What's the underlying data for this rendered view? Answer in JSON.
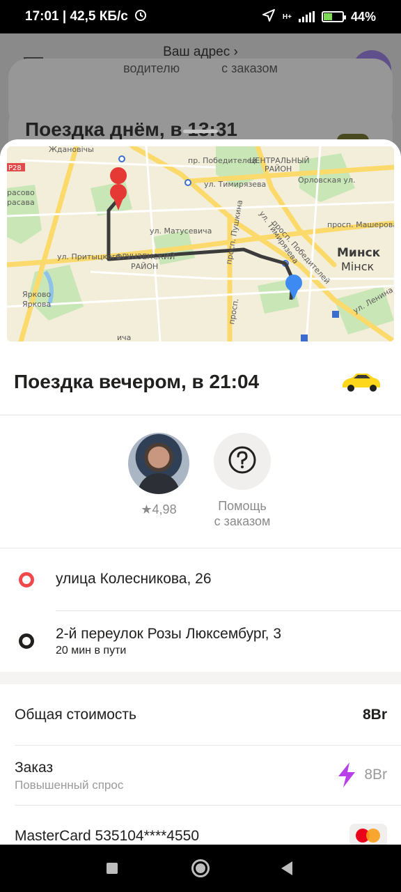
{
  "status_bar": {
    "time_speed": "17:01 | 42,5 КБ/с",
    "network": "H+",
    "battery": "44%"
  },
  "background": {
    "address_link": "Ваш адрес ›",
    "chips": [
      "водителю",
      "с заказом"
    ],
    "trip_title": "Поездка днём, в 13:31"
  },
  "map": {
    "labels": {
      "zhdanovichi": "Ждановічы",
      "pobediteley_top": "пр. Победителей",
      "center_district": "ЦЕНТРАЛЬНЫЙ",
      "district_word": "РАЙОН",
      "timiryazeva": "ул. Тимирязева",
      "orlovskaya": "Орловская ул.",
      "road_code": "Р28",
      "krasovo": "расово",
      "krasava": "расава",
      "pobediteley_side": "просп. Победителей",
      "masherova": "просп. Машерова",
      "matusevicha": "ул. Матусевича",
      "pushkina": "просп. Пушкина",
      "timiryazeva_side": "ул. Тимирязева",
      "minsk_ru": "Минск",
      "minsk_by": "Мінск",
      "pritytskogo": "ул. Притыцкого",
      "frunzensky": "ФРУНЗЕНСКИЙ",
      "frunzensky_district": "РАЙОН",
      "yarkovo_ru": "Ярково",
      "yarkovo_by": "Яркова",
      "lenina": "ул. Ленина",
      "prosp_bottom": "просп.",
      "scha": "ича"
    }
  },
  "trip": {
    "title": "Поездка вечером, в 21:04",
    "driver_rating": "★4,98",
    "help_label_line1": "Помощь",
    "help_label_line2": "с заказом"
  },
  "route": {
    "from": "улица Колесникова, 26",
    "to": "2-й переулок Розы Люксембург, 3",
    "duration": "20 мин в пути"
  },
  "price": {
    "total_label": "Общая стоимость",
    "total_value": "8Br",
    "order_label": "Заказ",
    "order_note": "Повышенный спрос",
    "order_value": "8Br",
    "payment_method": "MasterCard 535104****4550"
  },
  "colors": {
    "accent_red": "#f0484b",
    "pin_blue": "#3d8bf2",
    "surge_purple": "#b740e8",
    "taxi_yellow": "#fcd71c"
  }
}
